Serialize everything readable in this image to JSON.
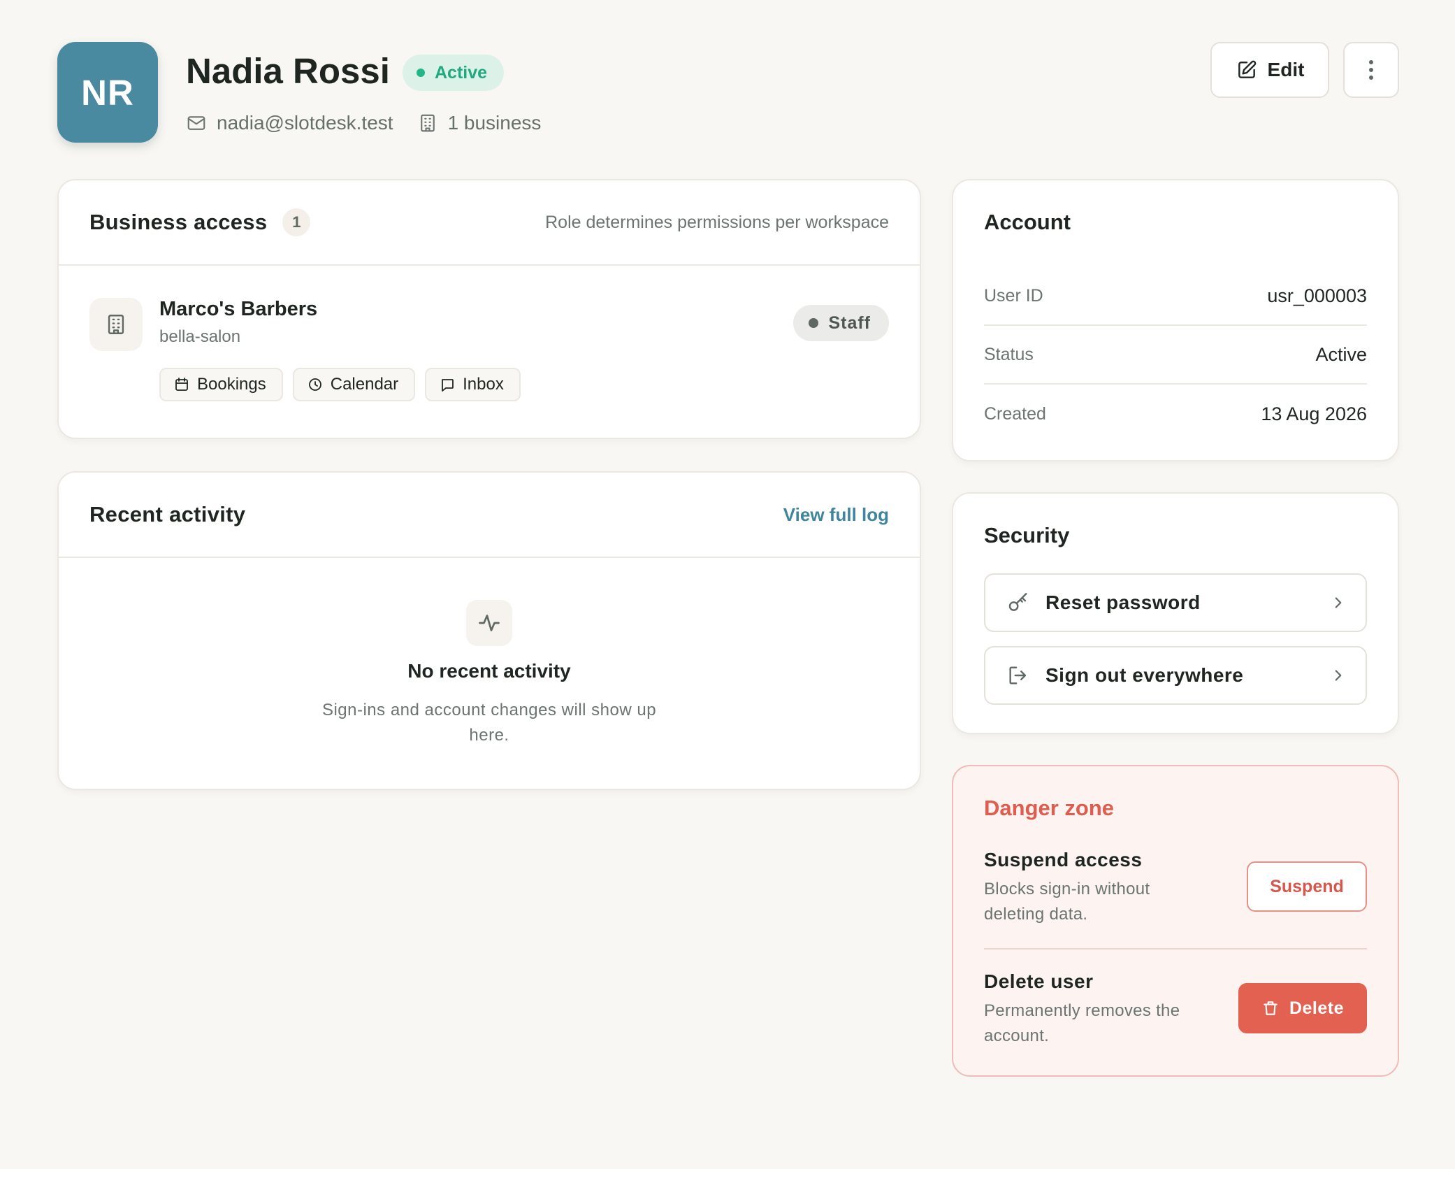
{
  "header": {
    "initials": "NR",
    "name": "Nadia Rossi",
    "status": "Active",
    "email": "nadia@slotdesk.test",
    "business_count": "1 business",
    "edit_label": "Edit"
  },
  "business_access": {
    "title": "Business access",
    "count": "1",
    "note": "Role determines permissions per workspace",
    "items": [
      {
        "name": "Marco's Barbers",
        "slug": "bella-salon",
        "role": "Staff",
        "permissions": [
          "Bookings",
          "Calendar",
          "Inbox"
        ]
      }
    ]
  },
  "recent_activity": {
    "title": "Recent activity",
    "link": "View full log",
    "empty_title": "No recent activity",
    "empty_text": "Sign-ins and account changes will show up here."
  },
  "account": {
    "title": "Account",
    "rows": [
      {
        "label": "User ID",
        "value": "usr_000003"
      },
      {
        "label": "Status",
        "value": "Active"
      },
      {
        "label": "Created",
        "value": "13 Aug 2026"
      }
    ]
  },
  "security": {
    "title": "Security",
    "reset_password": "Reset password",
    "sign_out_everywhere": "Sign out everywhere"
  },
  "danger_zone": {
    "title": "Danger zone",
    "suspend_title": "Suspend access",
    "suspend_desc": "Blocks sign-in without deleting data.",
    "suspend_button": "Suspend",
    "delete_title": "Delete user",
    "delete_desc": "Permanently removes the account.",
    "delete_button": "Delete"
  },
  "colors": {
    "accent": "#4a8aa0",
    "active": "#20a87f",
    "danger": "#e36151",
    "background": "#f9f7f3"
  },
  "icons": {
    "email": "mail-icon",
    "business": "building-icon",
    "edit": "pencil-square-icon",
    "more": "vertical-dots-icon",
    "bookings": "calendar-icon",
    "calendar": "clock-icon",
    "inbox": "chat-bubble-icon",
    "activity": "pulse-icon",
    "reset_password": "key-icon",
    "sign_out": "sign-out-icon",
    "delete": "trash-icon"
  }
}
